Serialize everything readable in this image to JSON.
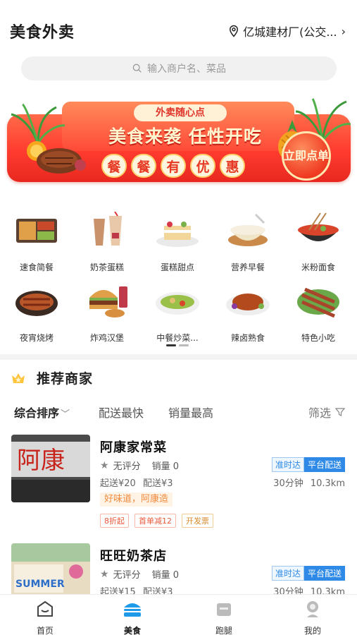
{
  "header": {
    "title": "美食外卖",
    "location": "亿城建材厂(公交..."
  },
  "search": {
    "placeholder": "输入商户名、菜品"
  },
  "banner": {
    "tag": "外卖随心点",
    "headline": "美食来袭 任性开吃",
    "sub_chars": [
      "餐",
      "餐",
      "有",
      "优",
      "惠"
    ],
    "button": "立即点单"
  },
  "categories": [
    {
      "label": "速食简餐"
    },
    {
      "label": "奶茶蛋糕"
    },
    {
      "label": "蛋糕甜点"
    },
    {
      "label": "营养早餐"
    },
    {
      "label": "米粉面食"
    },
    {
      "label": "夜宵烧烤"
    },
    {
      "label": "炸鸡汉堡"
    },
    {
      "label": "中餐炒菜..."
    },
    {
      "label": "辣卤熟食"
    },
    {
      "label": "特色小吃"
    }
  ],
  "recommend": {
    "title": "推荐商家"
  },
  "sort": {
    "comprehensive": "综合排序",
    "fastest": "配送最快",
    "best_selling": "销量最高",
    "filter": "筛选"
  },
  "shops": [
    {
      "name": "阿康家常菜",
      "rating": "无评分",
      "sales": "销量 0",
      "min_order": "起送¥20",
      "delivery_fee": "配送¥3",
      "badge_ontime": "准时达",
      "badge_platform": "平台配送",
      "time": "30分钟",
      "distance": "10.3km",
      "slogan": "好味道，阿康造",
      "tags": [
        "8折起",
        "首单减12",
        "开发票"
      ],
      "sign_text": "阿康"
    },
    {
      "name": "旺旺奶茶店",
      "rating": "无评分",
      "sales": "销量 0",
      "min_order": "起送¥15",
      "delivery_fee": "配送¥3",
      "badge_ontime": "准时达",
      "badge_platform": "平台配送",
      "time": "30分钟",
      "distance": "10.3km",
      "sign_text": "SUMMER"
    }
  ],
  "tabs": [
    {
      "label": "首页"
    },
    {
      "label": "美食"
    },
    {
      "label": "跑腿"
    },
    {
      "label": "我的"
    }
  ]
}
